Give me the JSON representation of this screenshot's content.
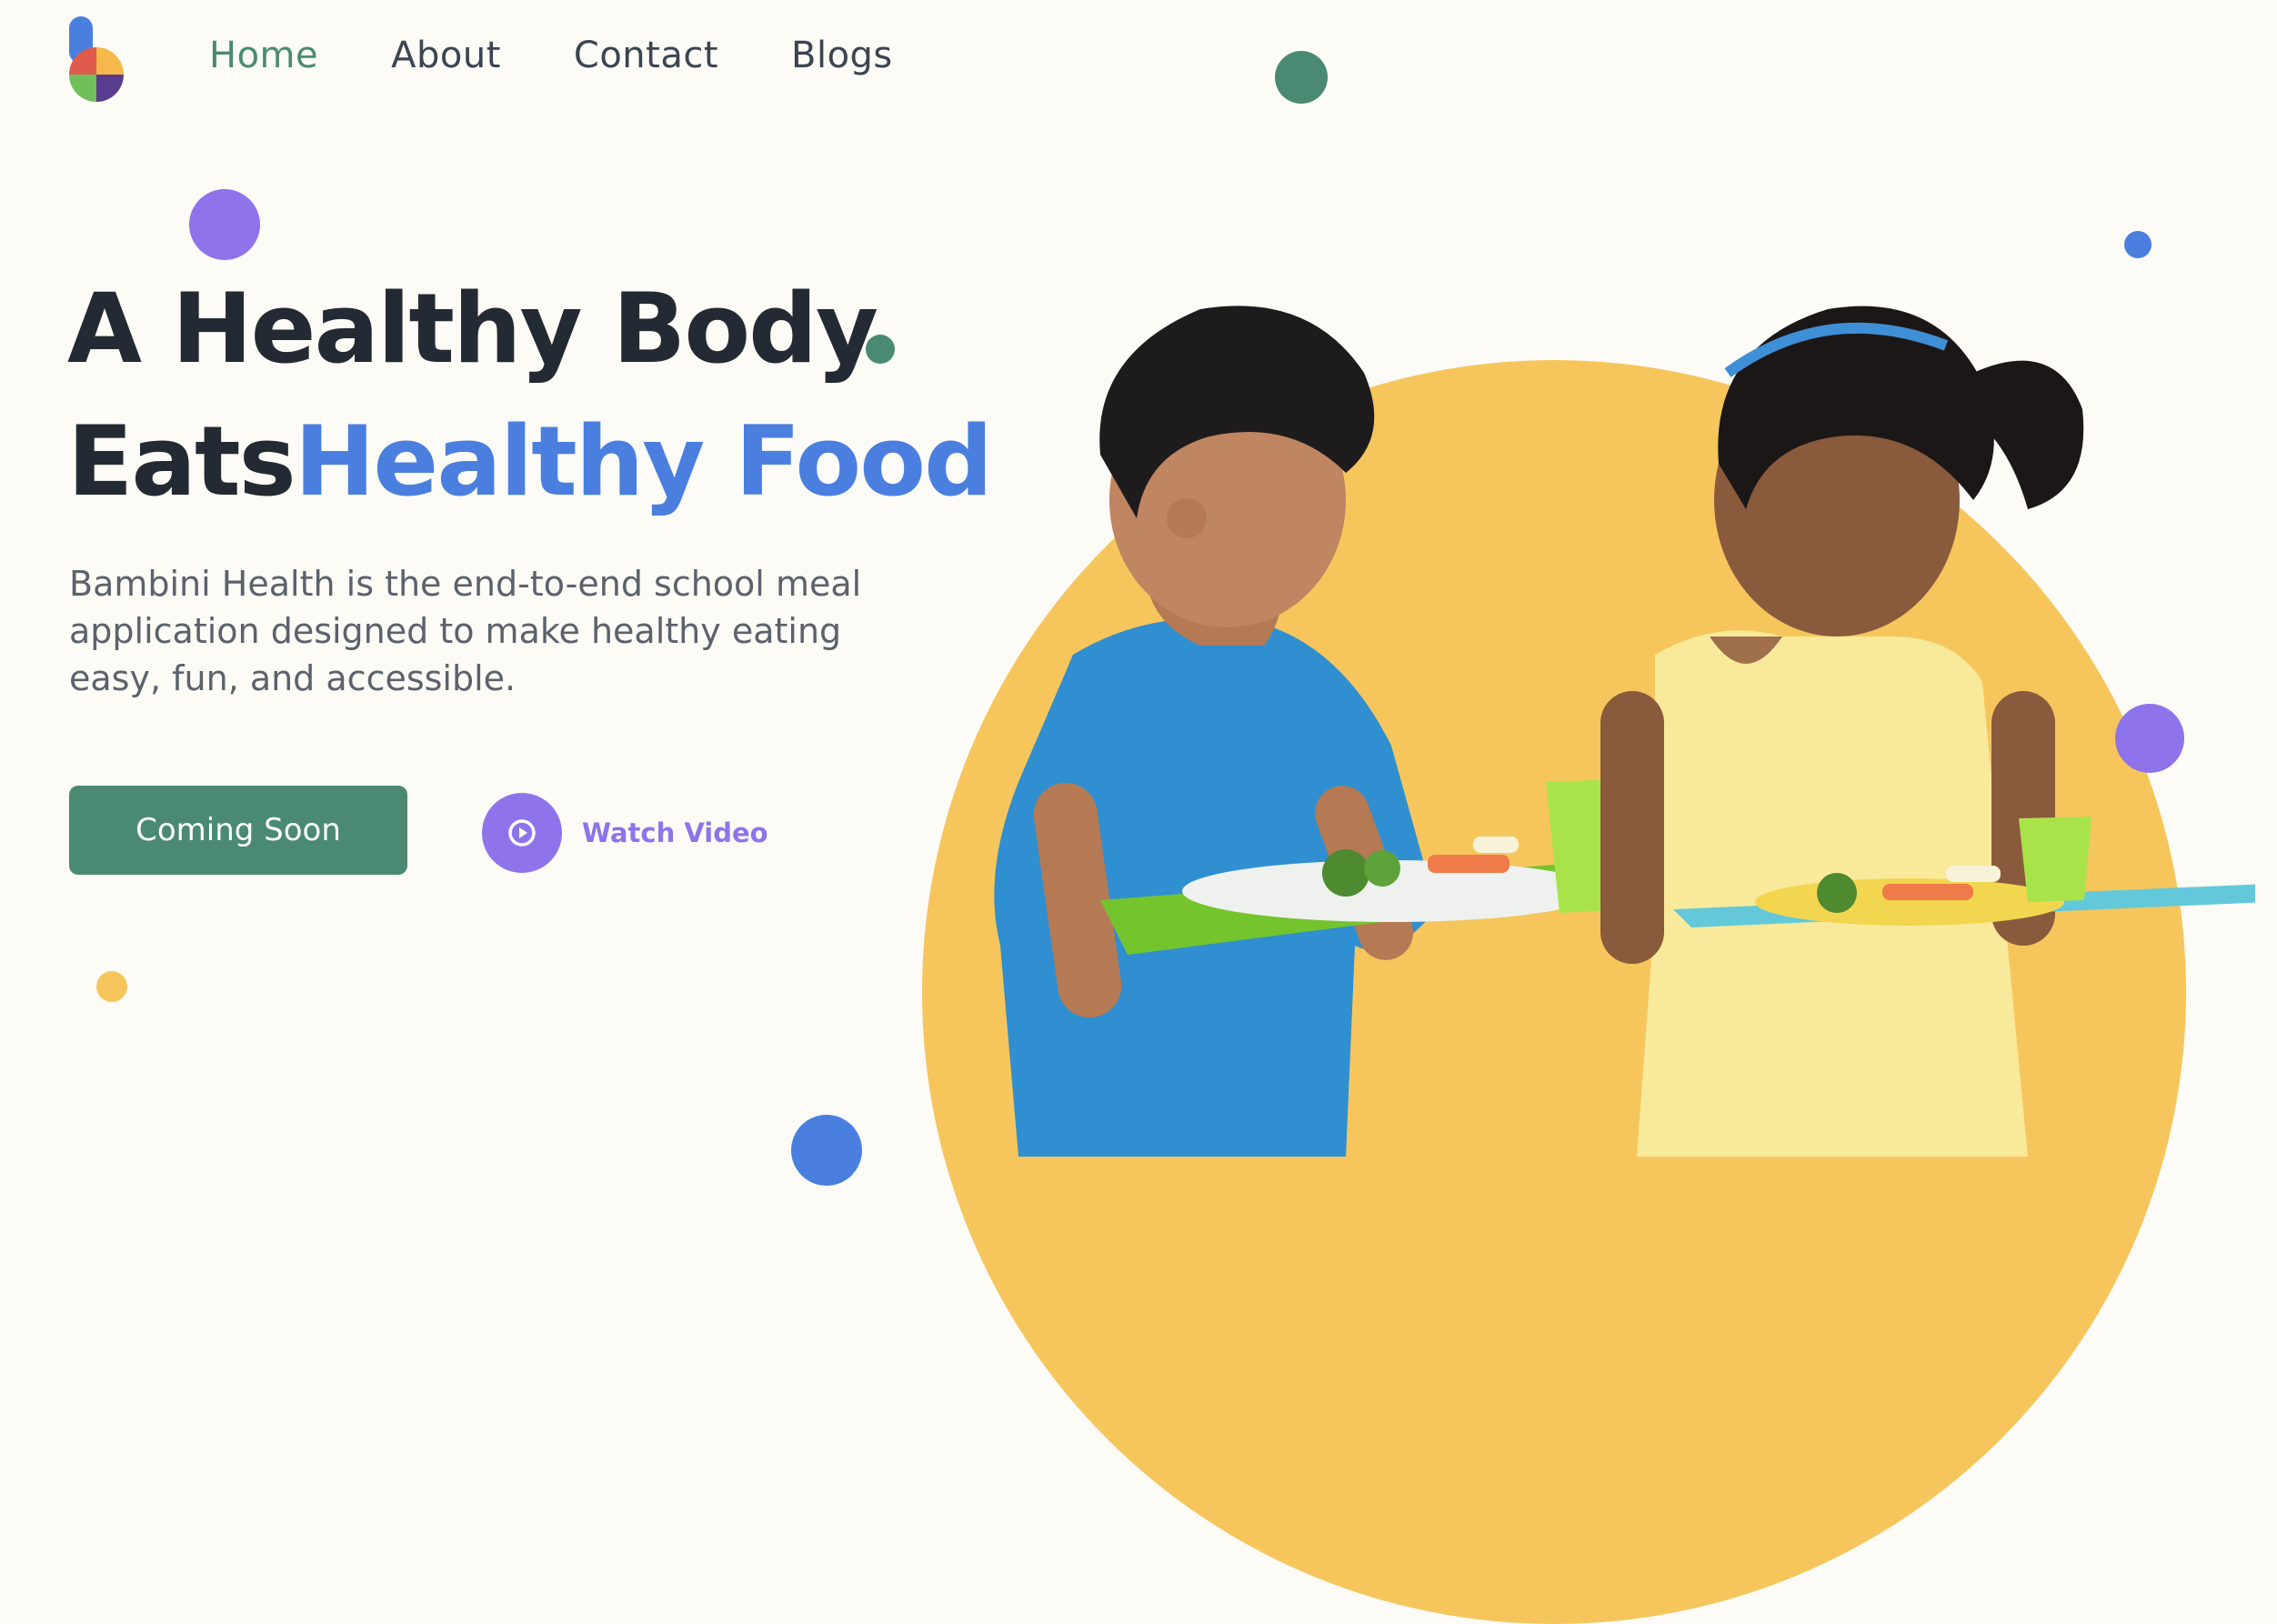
{
  "nav": {
    "items": [
      {
        "label": "Home",
        "active": true
      },
      {
        "label": "About",
        "active": false
      },
      {
        "label": "Contact",
        "active": false
      },
      {
        "label": "Blogs",
        "active": false
      }
    ]
  },
  "hero": {
    "line1": "A Healthy Body",
    "line2_dark": "Eats",
    "line2_accent": "Healthy Food",
    "description": "Bambini Health is the end-to-end school meal application designed to make healthy eating easy, fun, and accessible.",
    "cta_label": "Coming Soon",
    "watch_label": "Watch Video"
  },
  "colors": {
    "primary_green": "#4a8a72",
    "accent_blue": "#4a7fe0",
    "accent_purple": "#8f73ea",
    "accent_yellow": "#f6c65d",
    "text_dark": "#242a33",
    "background": "#fcfbf6"
  },
  "icons": {
    "logo": "bambini-logo-icon",
    "play": "play-icon"
  }
}
